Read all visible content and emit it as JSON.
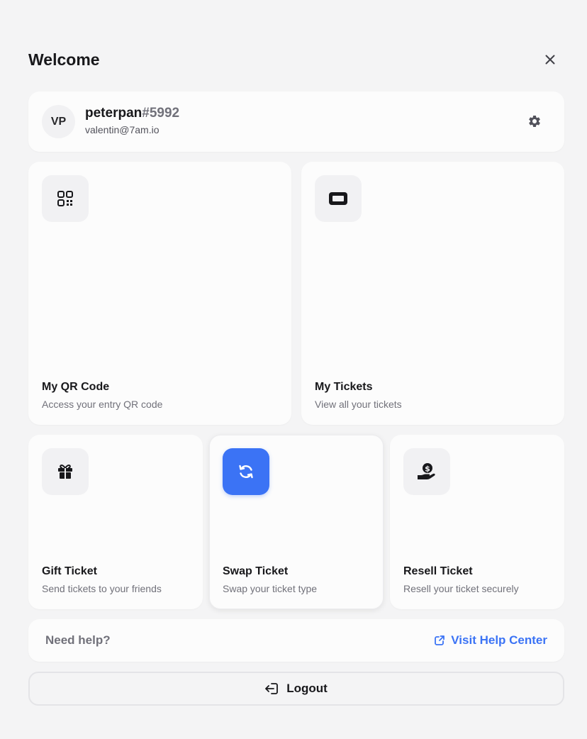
{
  "header": {
    "title": "Welcome"
  },
  "profile": {
    "initials": "VP",
    "name": "peterpan",
    "tag": "#5992",
    "email": "valentin@7am.io"
  },
  "tiles": [
    {
      "title": "My QR Code",
      "subtitle": "Access your entry QR code",
      "icon": "qr-code-icon"
    },
    {
      "title": "My Tickets",
      "subtitle": "View all your tickets",
      "icon": "ticket-icon"
    },
    {
      "title": "Gift Ticket",
      "subtitle": "Send tickets to your friends",
      "icon": "gift-icon"
    },
    {
      "title": "Swap Ticket",
      "subtitle": "Swap your ticket type",
      "icon": "swap-icon"
    },
    {
      "title": "Resell Ticket",
      "subtitle": "Resell your ticket securely",
      "icon": "hand-dollar-icon"
    }
  ],
  "help": {
    "label": "Need help?",
    "link": "Visit Help Center"
  },
  "logout": {
    "label": "Logout"
  },
  "colors": {
    "accent": "#3b73f5",
    "background": "#f4f4f5",
    "card": "#fcfcfc"
  }
}
